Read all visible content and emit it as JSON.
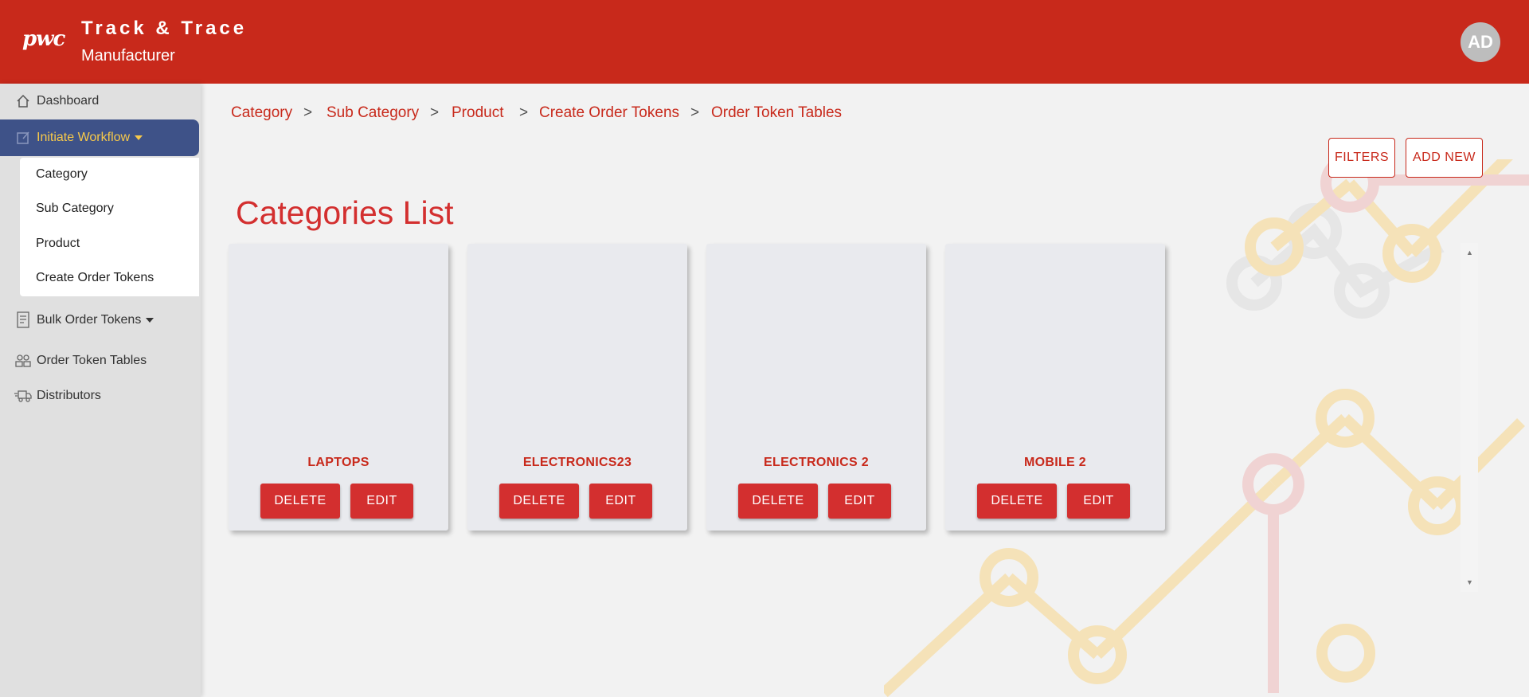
{
  "header": {
    "logo": "pwc",
    "title": "Track & Trace",
    "subtitle": "Manufacturer",
    "avatar_initials": "AD",
    "color": "#c8291b"
  },
  "sidebar": {
    "items": [
      {
        "label": "Dashboard",
        "icon": "home-icon"
      },
      {
        "label": "Initiate Workflow",
        "icon": "edit-icon",
        "active": true,
        "expanded": true
      },
      {
        "label": "Bulk Order Tokens",
        "icon": "document-icon"
      },
      {
        "label": "Order Token Tables",
        "icon": "users-icon"
      },
      {
        "label": "Distributors",
        "icon": "truck-icon"
      }
    ],
    "submenu": [
      "Category",
      "Sub Category",
      "Product",
      "Create Order Tokens"
    ],
    "active_color": "#3e5288",
    "active_text_color": "#f7c94a"
  },
  "breadcrumb": [
    "Category",
    "Sub Category",
    "Product",
    "Create Order Tokens",
    "Order Token Tables"
  ],
  "breadcrumb_separator": ">",
  "actions": {
    "filters": "FILTERS",
    "add_new": "ADD NEW"
  },
  "page_title": "Categories List",
  "cards": [
    {
      "name": "LAPTOPS",
      "delete": "DELETE",
      "edit": "EDIT"
    },
    {
      "name": "ELECTRONICS23",
      "delete": "DELETE",
      "edit": "EDIT"
    },
    {
      "name": "ELECTRONICS 2",
      "delete": "DELETE",
      "edit": "EDIT"
    },
    {
      "name": "MOBILE 2",
      "delete": "DELETE",
      "edit": "EDIT"
    }
  ],
  "scrollbar": {
    "up_arrow": "▲",
    "down_arrow": "▼"
  }
}
